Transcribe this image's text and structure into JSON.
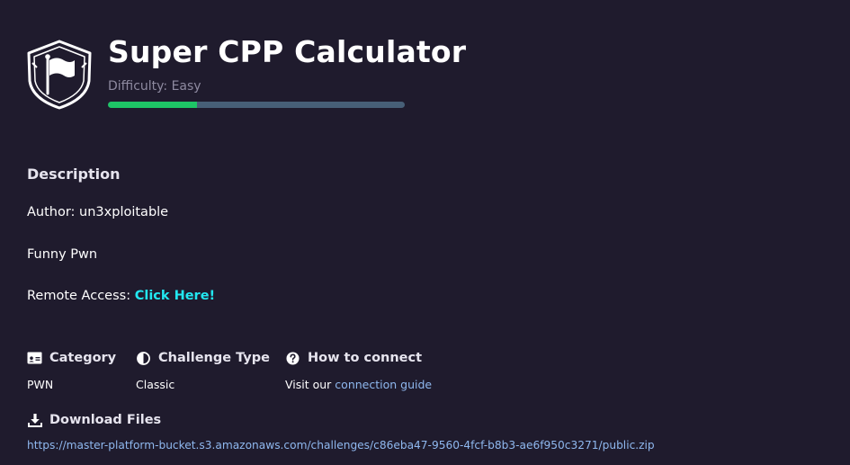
{
  "challenge": {
    "title": "Super CPP Calculator",
    "difficulty_label": "Difficulty: Easy",
    "difficulty_fraction": 0.3
  },
  "description": {
    "heading": "Description",
    "author_line": "Author: un3xploitable",
    "summary": "Funny Pwn",
    "remote_prefix": "Remote Access: ",
    "remote_link_label": "Click Here!"
  },
  "meta": {
    "category": {
      "label": "Category",
      "value": "PWN",
      "icon": "id-card-icon"
    },
    "challenge_type": {
      "label": "Challenge Type",
      "value": "Classic",
      "icon": "half-circle-icon"
    },
    "connect": {
      "label": "How to connect",
      "prefix": "Visit our ",
      "link_label": "connection guide",
      "icon": "question-circle-icon"
    }
  },
  "downloads": {
    "label": "Download Files",
    "icon": "download-icon",
    "url": "https://master-platform-bucket.s3.amazonaws.com/challenges/c86eba47-9560-4fcf-b8b3-ae6f950c3271/public.zip"
  },
  "colors": {
    "background": "#1f1b2d",
    "difficulty_fill": "#1ec566",
    "difficulty_track": "#475f77",
    "remote_link": "#22e7f0",
    "link": "#8fb8ef"
  }
}
